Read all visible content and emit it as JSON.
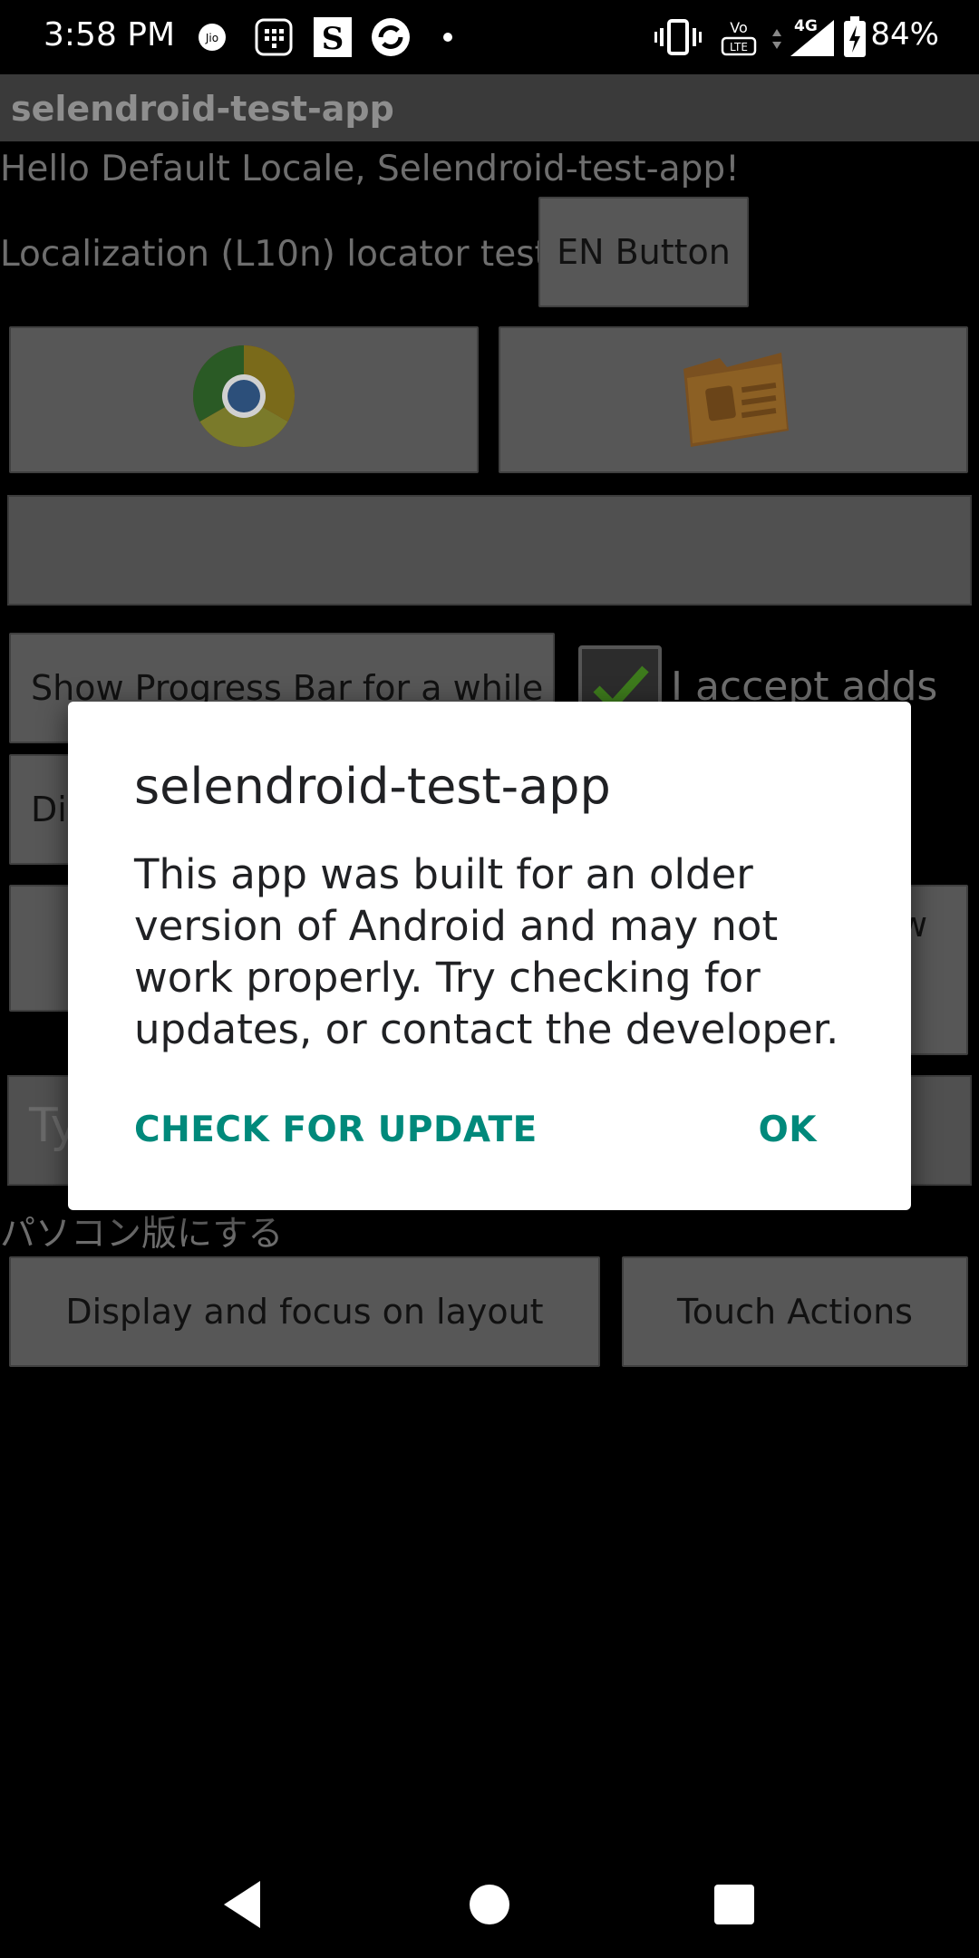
{
  "status_bar": {
    "time": "3:58 PM",
    "battery_percent": "84%",
    "network": "4G",
    "icons": [
      "jio-icon",
      "sim-menu-icon",
      "s-app-icon",
      "refresh-app-icon",
      "dot-icon",
      "vibrate-icon",
      "volte-icon",
      "signal-icon",
      "battery-charging-icon"
    ]
  },
  "app": {
    "title": "selendroid-test-app",
    "hello_text": "Hello Default Locale, Selendroid-test-app!",
    "l10n_label": "Localization (L10n) locator test",
    "en_button": "EN Button",
    "browser_button_icon": "chrome-icon",
    "contacts_button_icon": "contacts-folder-icon",
    "progress_button": "Show Progress Bar for a while",
    "accept_adds_label": "I accept adds",
    "accept_adds_checked": true,
    "partial_button_left": "Dis",
    "partial_button_right": "w",
    "text_field_placeholder_partial": "Ty",
    "japanese_text": "パソコン版にする",
    "display_focus_button": "Display and focus on layout",
    "touch_actions_button": "Touch Actions"
  },
  "dialog": {
    "title": "selendroid-test-app",
    "message": "This app was built for an older version of Android and may not work properly. Try checking for updates, or contact the developer.",
    "check_update_label": "CHECK FOR UPDATE",
    "ok_label": "OK",
    "accent_color": "#00897b"
  },
  "nav_bar": {
    "back": "back-icon",
    "home": "home-icon",
    "recents": "recents-icon"
  }
}
